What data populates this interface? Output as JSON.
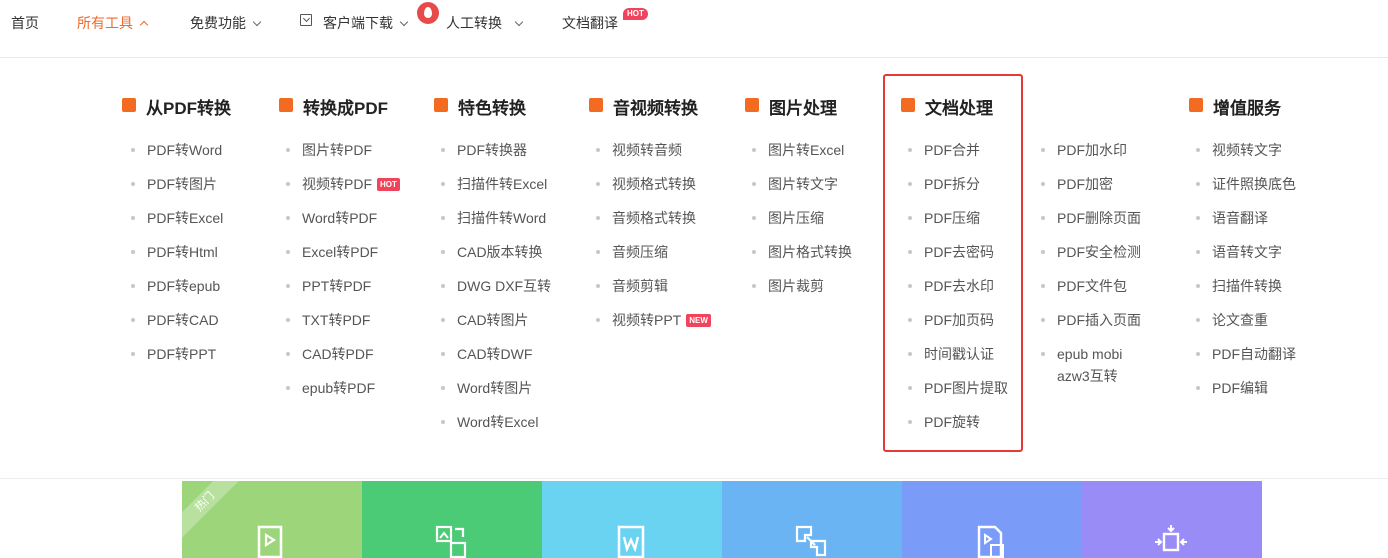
{
  "nav": {
    "home": "首页",
    "all_tools": "所有工具",
    "free_features": "免费功能",
    "client_download": "客户端下载",
    "manual_convert": "人工转换",
    "doc_translate": "文档翻译",
    "hot_badge": "HOT",
    "accent_color": "#f06a2a"
  },
  "columns": [
    {
      "title": "从PDF转换",
      "icon": "pdf-convert-icon",
      "items": [
        "PDF转Word",
        "PDF转图片",
        "PDF转Excel",
        "PDF转Html",
        "PDF转epub",
        "PDF转CAD",
        "PDF转PPT"
      ]
    },
    {
      "title": "转换成PDF",
      "icon": "to-pdf-icon",
      "items": [
        "图片转PDF",
        "视频转PDF",
        "Word转PDF",
        "Excel转PDF",
        "PPT转PDF",
        "TXT转PDF",
        "CAD转PDF",
        "epub转PDF"
      ],
      "hot_item_badge": "HOT"
    },
    {
      "title": "特色转换",
      "icon": "star-icon",
      "items": [
        "PDF转换器",
        "扫描件转Excel",
        "扫描件转Word",
        "CAD版本转换",
        "DWG DXF互转",
        "CAD转图片",
        "CAD转DWF",
        "Word转图片",
        "Word转Excel"
      ]
    },
    {
      "title": "音视频转换",
      "icon": "video-icon",
      "items": [
        "视频转音频",
        "视频格式转换",
        "音频格式转换",
        "音频压缩",
        "音频剪辑",
        "视频转PPT"
      ],
      "new_item_badge": "NEW"
    },
    {
      "title": "图片处理",
      "icon": "image-icon",
      "items": [
        "图片转Excel",
        "图片转文字",
        "图片压缩",
        "图片格式转换",
        "图片裁剪"
      ]
    },
    {
      "title": "文档处理",
      "icon": "document-icon",
      "items": [
        "PDF合并",
        "PDF拆分",
        "PDF压缩",
        "PDF去密码",
        "PDF去水印",
        "PDF加页码",
        "时间戳认证",
        "PDF图片提取",
        "PDF旋转"
      ]
    },
    {
      "title": "",
      "icon": "",
      "items": [
        "PDF加水印",
        "PDF加密",
        "PDF删除页面",
        "PDF安全检测",
        "PDF文件包",
        "PDF插入页面",
        "epub mobi azw3互转"
      ]
    },
    {
      "title": "增值服务",
      "icon": "list-icon",
      "items": [
        "视频转文字",
        "证件照换底色",
        "语音翻译",
        "语音转文字",
        "扫描件转换",
        "论文查重",
        "PDF自动翻译",
        "PDF编辑"
      ]
    }
  ],
  "tiles": {
    "hot_ribbon": "热门",
    "colors": [
      "#9dd67a",
      "#4ccb76",
      "#6ad3f2",
      "#6ab4f4",
      "#7a9cf8",
      "#9a8cf6"
    ],
    "icons": [
      "pdf-to-ppt-icon",
      "image-convert-icon",
      "word-icon",
      "convert-arrows-icon",
      "video-to-doc-icon",
      "merge-icon"
    ]
  },
  "highlight_color": "#e53935"
}
